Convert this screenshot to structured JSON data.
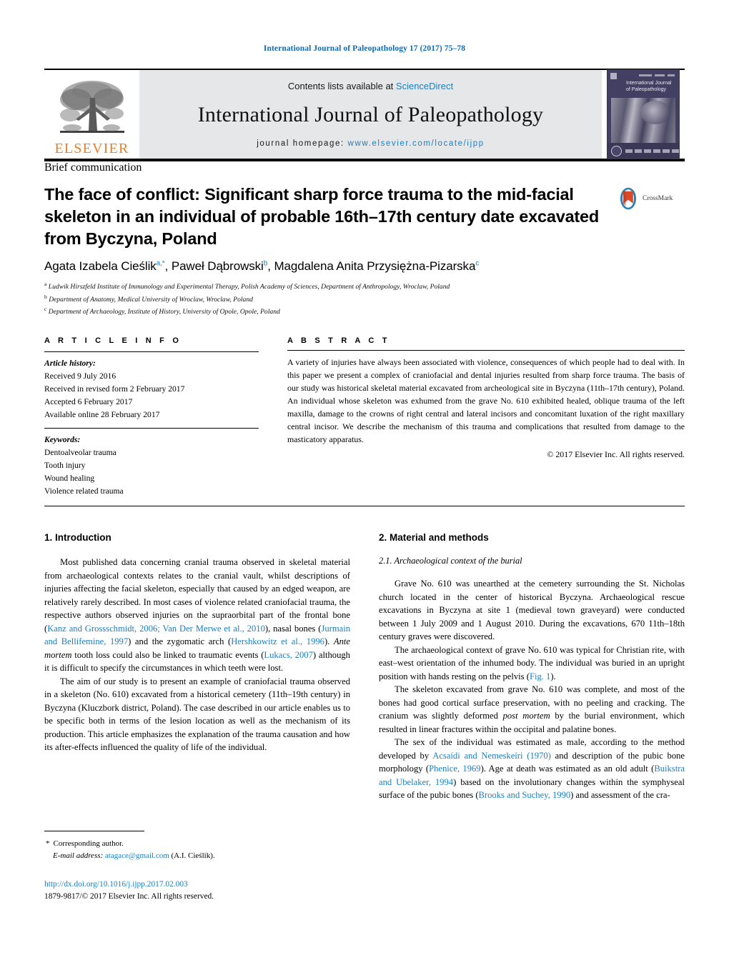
{
  "running_head": "International Journal of Paleopathology 17 (2017) 75–78",
  "masthead": {
    "publisher_name": "ELSEVIER",
    "publisher_logo_name": "elsevier-tree-logo",
    "contents_prefix": "Contents lists available at ",
    "contents_link": "ScienceDirect",
    "journal_title": "International Journal of Paleopathology",
    "homepage_label": "journal  homepage:  ",
    "homepage_url": "www.elsevier.com/locate/ijpp",
    "cover_title": "International Journal of Paleopathology",
    "band_color": "#e6e7e9",
    "link_color": "#1a7fc1",
    "elsevier_orange": "#ef7d22"
  },
  "article": {
    "type": "Brief communication",
    "title": "The face of conflict: Significant sharp force trauma to the mid-facial skeleton in an individual of probable 16th–17th century date excavated from Byczyna, Poland",
    "crossmark_label": "CrossMark",
    "authors_html": "Agata Izabela Cieślik<sup>a,*</sup>, Paweł Dąbrowski<sup>b</sup>, Magdalena Anita Przysiężna-Pizarska<sup>c</sup>",
    "affiliations": [
      {
        "marker": "a",
        "text": "Ludwik Hirszfeld Institute of Immunology and Experimental Therapy, Polish Academy of Sciences, Department of Anthropology, Wroclaw, Poland"
      },
      {
        "marker": "b",
        "text": "Department of Anatomy, Medical University of Wroclaw, Wroclaw, Poland"
      },
      {
        "marker": "c",
        "text": "Department of Archaeology, Institute of History, University of Opole, Opole, Poland"
      }
    ]
  },
  "article_info": {
    "heading": "A R T I C L E    I N F O",
    "history_label": "Article history:",
    "history": [
      "Received 9 July 2016",
      "Received in revised form 2 February 2017",
      "Accepted 6 February 2017",
      "Available online 28 February 2017"
    ],
    "keywords_label": "Keywords:",
    "keywords": [
      "Dentoalveolar trauma",
      "Tooth injury",
      "Wound healing",
      "Violence related trauma"
    ]
  },
  "abstract": {
    "heading": "A B S T R A C T",
    "text": "A variety of injuries have always been associated with violence, consequences of which people had to deal with. In this paper we present a complex of craniofacial and dental injuries resulted from sharp force trauma. The basis of our study was historical skeletal material excavated from archeological site in Byczyna (11th–17th century), Poland. An individual whose skeleton was exhumed from the grave No. 610 exhibited healed, oblique trauma of the left maxilla, damage to the crowns of right central and lateral incisors and concomitant luxation of the right maxillary central incisor. We describe the mechanism of this trauma and complications that resulted from damage to the masticatory apparatus.",
    "copyright": "© 2017 Elsevier Inc. All rights reserved."
  },
  "sections": {
    "introduction": {
      "heading": "1.  Introduction",
      "paragraph_1_parts": [
        {
          "t": "Most published data concerning cranial trauma observed in skeletal material from archaeological contexts relates to the cranial vault, whilst descriptions of injuries affecting the facial skeleton, especially that caused by an edged weapon, are relatively rarely described. In most cases of violence related craniofacial trauma, the respective authors observed injuries on the supraorbital part of the frontal bone (",
          "k": "plain"
        },
        {
          "t": "Kanz and Grossschmidt, 2006; Van Der Merwe et al., 2010",
          "k": "ref"
        },
        {
          "t": "), nasal bones (",
          "k": "plain"
        },
        {
          "t": "Jurmain and Bellifemine, 1997",
          "k": "ref"
        },
        {
          "t": ") and the zygomatic arch (",
          "k": "plain"
        },
        {
          "t": "Hershkowitz et al., 1996",
          "k": "ref"
        },
        {
          "t": "). ",
          "k": "plain"
        },
        {
          "t": "Ante mortem",
          "k": "italic"
        },
        {
          "t": " tooth loss could also be linked to traumatic events (",
          "k": "plain"
        },
        {
          "t": "Lukacs, 2007",
          "k": "ref"
        },
        {
          "t": ") although it is difficult to specify the circumstances in which teeth were lost.",
          "k": "plain"
        }
      ],
      "paragraph_2_parts": [
        {
          "t": "The aim of our study is to present an example of craniofacial trauma observed in a skeleton (No. 610) excavated from a historical cemetery (11th–19th century) in Byczyna (Kluczbork district, Poland). The case described in our article enables us to be specific both in terms of the lesion location as well as the mechanism of its production. This article emphasizes the explanation of the trauma causation and how its after-effects influenced the quality of life of the individual.",
          "k": "plain"
        }
      ]
    },
    "materials": {
      "heading": "2.  Material and methods",
      "subheading": "2.1.  Archaeological context of the burial",
      "paragraph_1_parts": [
        {
          "t": "Grave No. 610 was unearthed at the cemetery surrounding the St. Nicholas church located in the center of historical Byczyna. Archaeological rescue excavations in Byczyna at site 1 (medieval town graveyard) were conducted between 1 July 2009 and 1 August 2010. During the excavations, 670 11th–18th century graves were discovered.",
          "k": "plain"
        }
      ],
      "paragraph_2_parts": [
        {
          "t": "The archaeological context of grave No. 610 was typical for Christian rite, with east–west orientation of the inhumed body. The individual was buried in an upright position with hands resting on the pelvis (",
          "k": "plain"
        },
        {
          "t": "Fig. 1",
          "k": "ref"
        },
        {
          "t": ").",
          "k": "plain"
        }
      ],
      "paragraph_3_parts": [
        {
          "t": "The skeleton excavated from grave No. 610 was complete, and most of the bones had good cortical surface preservation, with no peeling and cracking. The cranium was slightly deformed ",
          "k": "plain"
        },
        {
          "t": "post mortem",
          "k": "italic"
        },
        {
          "t": " by the burial environment, which resulted in linear fractures within the occipital and palatine bones.",
          "k": "plain"
        }
      ],
      "paragraph_4_parts": [
        {
          "t": "The sex of the individual was estimated as male, according to the method developed by ",
          "k": "plain"
        },
        {
          "t": "Acsaídi and Nemeskeíri (1970)",
          "k": "ref"
        },
        {
          "t": " and description of the pubic bone morphology (",
          "k": "plain"
        },
        {
          "t": "Phenice, 1969",
          "k": "ref"
        },
        {
          "t": "). Age at death was estimated as an old adult (",
          "k": "plain"
        },
        {
          "t": "Buikstra and Ubelaker, 1994",
          "k": "ref"
        },
        {
          "t": ") based on the involutionary changes within the symphyseal surface of the pubic bones (",
          "k": "plain"
        },
        {
          "t": "Brooks and Suchey, 1990",
          "k": "ref"
        },
        {
          "t": ") and assessment of the cra-",
          "k": "plain"
        }
      ]
    }
  },
  "footnotes": {
    "corresponding_marker": "*",
    "corresponding_label": "Corresponding author.",
    "email_label": "E-mail address:",
    "email": "atagace@gmail.com",
    "email_owner": "(A.I. Cieślik).",
    "doi": "http://dx.doi.org/10.1016/j.ijpp.2017.02.003",
    "issn_line": "1879-9817/© 2017 Elsevier Inc. All rights reserved."
  }
}
